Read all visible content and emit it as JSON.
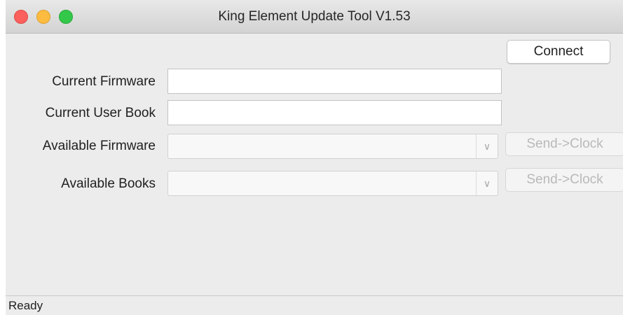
{
  "window": {
    "title": "King Element Update Tool V1.53"
  },
  "toolbar": {
    "connect_label": "Connect"
  },
  "form": {
    "current_firmware": {
      "label": "Current Firmware",
      "value": ""
    },
    "current_user_book": {
      "label": "Current User Book",
      "value": ""
    },
    "available_firmware": {
      "label": "Available Firmware",
      "selected": "",
      "send_label": "Send->Clock"
    },
    "available_books": {
      "label": "Available Books",
      "selected": "",
      "send_label": "Send->Clock"
    }
  },
  "statusbar": {
    "text": "Ready"
  },
  "colors": {
    "close": "#fc605c",
    "minimize": "#fdbc40",
    "zoom": "#34c84a",
    "window_bg": "#ececec",
    "disabled_text": "#b9b9b9"
  }
}
